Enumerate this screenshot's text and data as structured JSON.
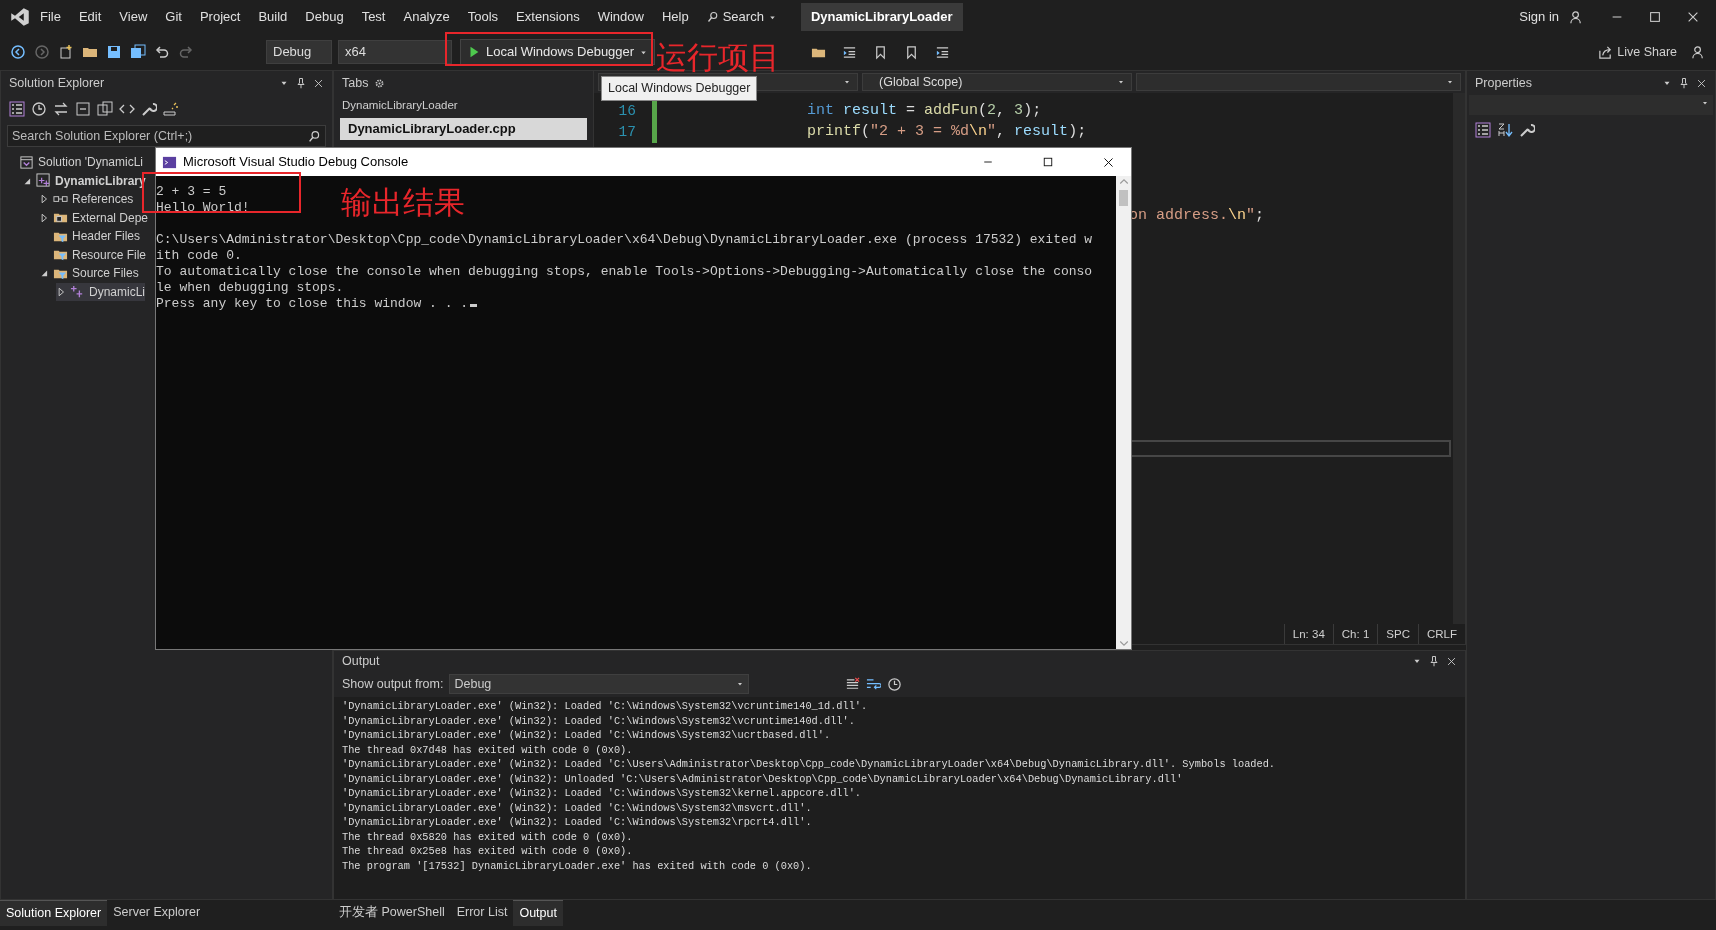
{
  "menu_bar": {
    "items": [
      "File",
      "Edit",
      "View",
      "Git",
      "Project",
      "Build",
      "Debug",
      "Test",
      "Analyze",
      "Tools",
      "Extensions",
      "Window",
      "Help"
    ],
    "search": "Search",
    "solution_title": "DynamicLibraryLoader",
    "sign_in": "Sign in"
  },
  "toolbar": {
    "configuration": "Debug",
    "platform": "x64",
    "run_button": "Local Windows Debugger",
    "tooltip": "Local Windows Debugger",
    "live_share": "Live Share"
  },
  "annotations": [
    {
      "kind": "run",
      "text": "运行项目"
    },
    {
      "kind": "output",
      "text": "输出结果"
    }
  ],
  "solution_explorer": {
    "title": "Solution Explorer",
    "search_placeholder": "Search Solution Explorer (Ctrl+;)",
    "tree": [
      {
        "label": "Solution 'DynamicLi",
        "kind": "solution",
        "selected": false,
        "children": [
          {
            "label": "DynamicLibrary",
            "kind": "project",
            "expanded": true,
            "selected": false,
            "children": [
              {
                "label": "References",
                "kind": "references",
                "expanded": false,
                "selected": false
              },
              {
                "label": "External Depe",
                "kind": "external",
                "expanded": false,
                "selected": false
              },
              {
                "label": "Header Files",
                "kind": "filter",
                "selected": false
              },
              {
                "label": "Resource File",
                "kind": "filter",
                "selected": false
              },
              {
                "label": "Source Files",
                "kind": "filter",
                "expanded": true,
                "selected": false,
                "children": [
                  {
                    "label": "DynamicLi",
                    "kind": "cpp",
                    "expanded": false,
                    "selected": true
                  }
                ]
              }
            ]
          }
        ]
      }
    ]
  },
  "editor": {
    "tabs_title": "Tabs",
    "group": "DynamicLibraryLoader",
    "files": [
      {
        "label": "DynamicLibraryLoader.cpp",
        "selected": true
      }
    ],
    "scope": "(Global Scope)",
    "code_lines": [
      {
        "number": "16",
        "tokens": [
          {
            "kind": "keyword",
            "text": "int"
          },
          {
            "kind": "variable",
            "text": " result"
          },
          {
            "kind": "plain",
            "text": " = "
          },
          {
            "kind": "function",
            "text": "addFun"
          },
          {
            "kind": "plain",
            "text": "("
          },
          {
            "kind": "number",
            "text": "2"
          },
          {
            "kind": "plain",
            "text": ", "
          },
          {
            "kind": "number",
            "text": "3"
          },
          {
            "kind": "plain",
            "text": ");"
          }
        ]
      },
      {
        "number": "17",
        "tokens": [
          {
            "kind": "function",
            "text": "printf"
          },
          {
            "kind": "plain",
            "text": "("
          },
          {
            "kind": "string",
            "text": "\"2 + 3 = %d"
          },
          {
            "kind": "escape",
            "text": "\\n"
          },
          {
            "kind": "string",
            "text": "\""
          },
          {
            "kind": "plain",
            "text": ", "
          },
          {
            "kind": "variable",
            "text": "result"
          },
          {
            "kind": "plain",
            "text": ");"
          }
        ]
      }
    ],
    "fragment": [
      {
        "kind": "string",
        "text": "on address."
      },
      {
        "kind": "escape",
        "text": "\\n"
      },
      {
        "kind": "string",
        "text": "\""
      },
      {
        "kind": "plain",
        "text": ";"
      }
    ],
    "status": [
      "Ln: 34",
      "Ch: 1",
      "SPC",
      "CRLF"
    ]
  },
  "console": {
    "title": "Microsoft Visual Studio Debug Console",
    "program_output": [
      "2 + 3 = 5",
      "Hello World!"
    ],
    "messages": [
      "C:\\Users\\Administrator\\Desktop\\Cpp_code\\DynamicLibraryLoader\\x64\\Debug\\DynamicLibraryLoader.exe (process 17532) exited w",
      "ith code 0.",
      "To automatically close the console when debugging stops, enable Tools->Options->Debugging->Automatically close the conso",
      "le when debugging stops.",
      "Press any key to close this window . . ."
    ]
  },
  "output": {
    "title": "Output",
    "source_label": "Show output from:",
    "source": "Debug",
    "lines": [
      "'DynamicLibraryLoader.exe' (Win32): Loaded 'C:\\Windows\\System32\\vcruntime140_1d.dll'.",
      "'DynamicLibraryLoader.exe' (Win32): Loaded 'C:\\Windows\\System32\\vcruntime140d.dll'.",
      "'DynamicLibraryLoader.exe' (Win32): Loaded 'C:\\Windows\\System32\\ucrtbased.dll'.",
      "The thread 0x7d48 has exited with code 0 (0x0).",
      "'DynamicLibraryLoader.exe' (Win32): Loaded 'C:\\Users\\Administrator\\Desktop\\Cpp_code\\DynamicLibraryLoader\\x64\\Debug\\DynamicLibrary.dll'. Symbols loaded.",
      "'DynamicLibraryLoader.exe' (Win32): Unloaded 'C:\\Users\\Administrator\\Desktop\\Cpp_code\\DynamicLibraryLoader\\x64\\Debug\\DynamicLibrary.dll'",
      "'DynamicLibraryLoader.exe' (Win32): Loaded 'C:\\Windows\\System32\\kernel.appcore.dll'.",
      "'DynamicLibraryLoader.exe' (Win32): Loaded 'C:\\Windows\\System32\\msvcrt.dll'.",
      "'DynamicLibraryLoader.exe' (Win32): Loaded 'C:\\Windows\\System32\\rpcrt4.dll'.",
      "The thread 0x5820 has exited with code 0 (0x0).",
      "The thread 0x25e8 has exited with code 0 (0x0).",
      "The program '[17532] DynamicLibraryLoader.exe' has exited with code 0 (0x0)."
    ]
  },
  "properties": {
    "title": "Properties"
  },
  "bottom_tabs_left": [
    {
      "label": "Solution Explorer",
      "selected": true
    },
    {
      "label": "Server Explorer",
      "selected": false
    }
  ],
  "bottom_tabs_middle": [
    {
      "label": "开发者 PowerShell",
      "selected": false
    },
    {
      "label": "Error List",
      "selected": false
    },
    {
      "label": "Output",
      "selected": true
    }
  ]
}
